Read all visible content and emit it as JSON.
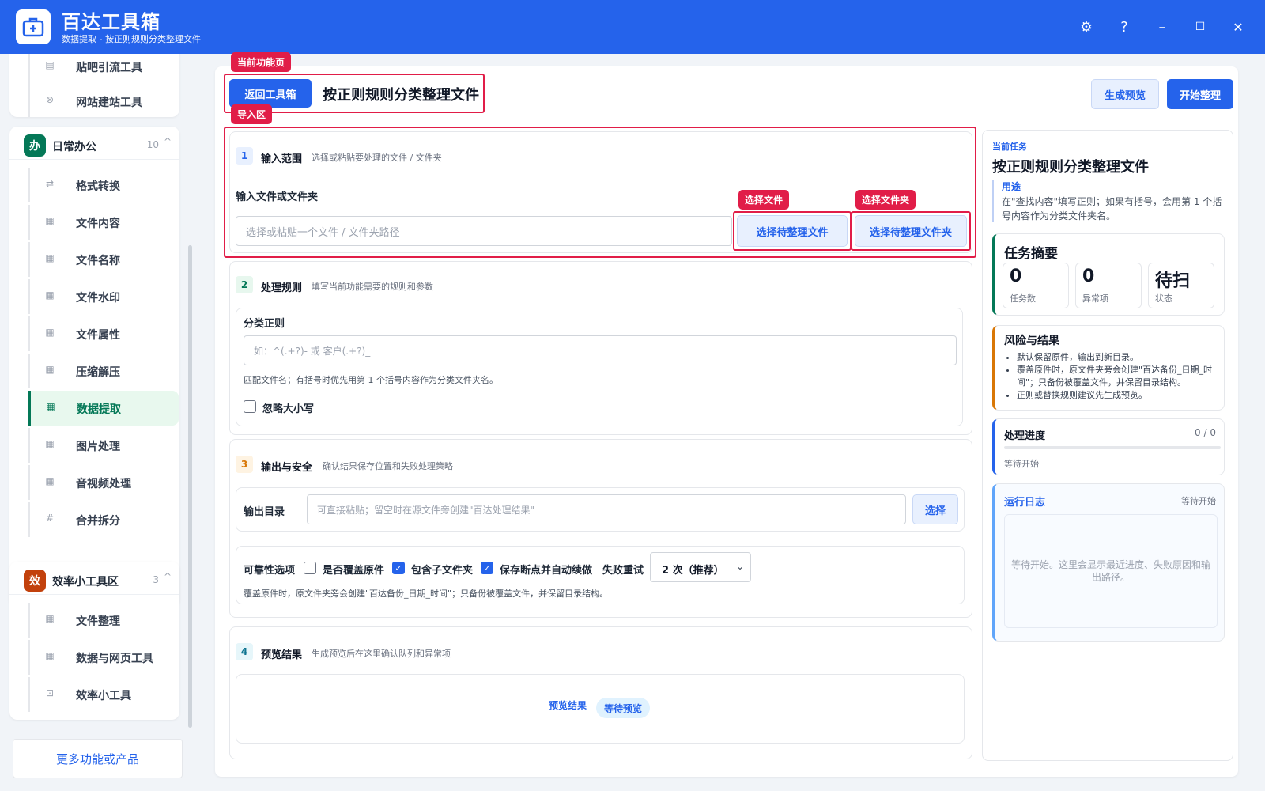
{
  "app": {
    "title": "百达工具箱",
    "subtitle": "数据提取 - 按正则规则分类整理文件"
  },
  "window": {
    "settings": "⚙",
    "help": "?",
    "minimize": "–",
    "maximize": "☐",
    "close": "✕"
  },
  "sidebar": {
    "top_items": [
      {
        "label": "贴吧引流工具",
        "icon": "note-icon"
      },
      {
        "label": "网站建站工具",
        "icon": "globe-icon"
      }
    ],
    "groups": [
      {
        "badge": "办",
        "badge_color": "#047857",
        "title": "日常办公",
        "count": "10",
        "caret": "^",
        "items": [
          {
            "label": "格式转换",
            "icon": "swap-icon"
          },
          {
            "label": "文件内容",
            "icon": "grid-icon"
          },
          {
            "label": "文件名称",
            "icon": "grid-icon"
          },
          {
            "label": "文件水印",
            "icon": "grid-icon"
          },
          {
            "label": "文件属性",
            "icon": "grid-icon"
          },
          {
            "label": "压缩解压",
            "icon": "grid-icon"
          },
          {
            "label": "数据提取",
            "icon": "grid-icon",
            "active": true
          },
          {
            "label": "图片处理",
            "icon": "grid-icon"
          },
          {
            "label": "音视频处理",
            "icon": "grid-icon"
          },
          {
            "label": "合并拆分",
            "icon": "hash-icon"
          }
        ]
      },
      {
        "badge": "效",
        "badge_color": "#c2410c",
        "title": "效率小工具区",
        "count": "3",
        "caret": "^",
        "items": [
          {
            "label": "文件整理",
            "icon": "grid-icon"
          },
          {
            "label": "数据与网页工具",
            "icon": "grid-icon"
          },
          {
            "label": "效率小工具",
            "icon": "box-icon"
          }
        ]
      }
    ],
    "more": "更多功能或产品"
  },
  "header": {
    "back_button": "返回工具箱",
    "title": "按正则规则分类整理文件",
    "preview_button": "生成预览",
    "start_button": "开始整理",
    "tag_current_page": "当前功能页",
    "tag_import_area": "导入区"
  },
  "section1": {
    "num": "1",
    "title": "输入范围",
    "desc": "选择或粘贴要处理的文件 / 文件夹",
    "field_label": "输入文件或文件夹",
    "placeholder": "选择或粘贴一个文件 / 文件夹路径",
    "select_file_button": "选择待整理文件",
    "select_folder_button": "选择待整理文件夹",
    "tag_select_file": "选择文件",
    "tag_select_folder": "选择文件夹"
  },
  "section2": {
    "num": "2",
    "title": "处理规则",
    "desc": "填写当前功能需要的规则和参数",
    "regex_label": "分类正则",
    "regex_placeholder": "如：^(.+?)- 或 客户(.+?)_",
    "regex_hint": "匹配文件名；有括号时优先用第 1 个括号内容作为分类文件夹名。",
    "ignore_case_label": "忽略大小写"
  },
  "section3": {
    "num": "3",
    "title": "输出与安全",
    "desc": "确认结果保存位置和失败处理策略",
    "output_label": "输出目录",
    "output_placeholder": "可直接粘贴；留空时在源文件旁创建\"百达处理结果\"",
    "choose_button": "选择",
    "reliability_label": "可靠性选项",
    "overwrite_label": "是否覆盖原件",
    "subfolders_label": "包含子文件夹",
    "resume_label": "保存断点并自动续做",
    "retry_label": "失败重试",
    "retry_value": "2 次（推荐）",
    "note": "覆盖原件时，原文件夹旁会创建\"百达备份_日期_时间\"；只备份被覆盖文件，并保留目录结构。"
  },
  "section4": {
    "num": "4",
    "title": "预览结果",
    "desc": "生成预览后在这里确认队列和异常项",
    "preview_label": "预览结果",
    "preview_badge": "等待预览"
  },
  "right_panel": {
    "kicker": "当前任务",
    "title": "按正则规则分类整理文件",
    "usage_title": "用途",
    "usage_text": "在\"查找内容\"填写正则；如果有括号，会用第 1 个括号内容作为分类文件夹名。",
    "summary_title": "任务摘要",
    "stats": [
      {
        "value": "0",
        "label": "任务数"
      },
      {
        "value": "0",
        "label": "异常项"
      },
      {
        "value": "待扫",
        "label": "状态"
      }
    ],
    "risk_title": "风险与结果",
    "risks": [
      "默认保留原件，输出到新目录。",
      "覆盖原件时，原文件夹旁会创建\"百达备份_日期_时间\"；只备份被覆盖文件，并保留目录结构。",
      "正则或替换规则建议先生成预览。"
    ],
    "progress_title": "处理进度",
    "progress_count": "0 / 0",
    "progress_value": 0,
    "progress_status": "等待开始",
    "log_title": "运行日志",
    "log_status": "等待开始",
    "log_placeholder": "等待开始。这里会显示最近进度、失败原因和输出路径。"
  },
  "colors": {
    "primary": "#2563eb",
    "annotation": "#e11d48",
    "active_green": "#047857",
    "warning": "#d97706"
  }
}
